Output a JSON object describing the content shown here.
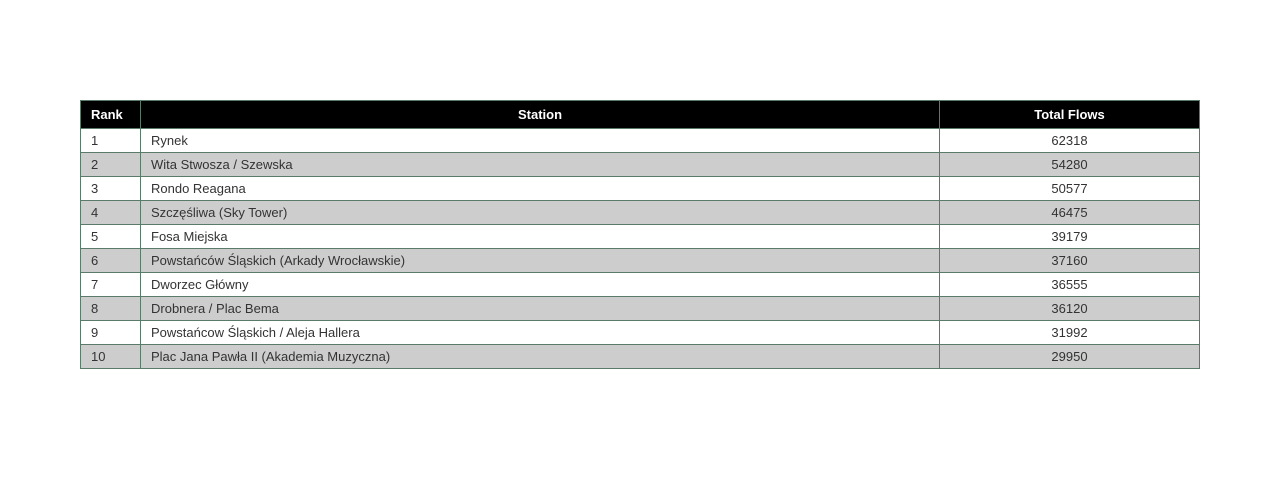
{
  "table": {
    "headers": {
      "rank": "Rank",
      "station": "Station",
      "flows": "Total Flows"
    },
    "rows": [
      {
        "rank": "1",
        "station": "Rynek",
        "flows": "62318"
      },
      {
        "rank": "2",
        "station": "Wita Stwosza / Szewska",
        "flows": "54280"
      },
      {
        "rank": "3",
        "station": "Rondo Reagana",
        "flows": "50577"
      },
      {
        "rank": "4",
        "station": "Szczęśliwa (Sky Tower)",
        "flows": "46475"
      },
      {
        "rank": "5",
        "station": "Fosa Miejska",
        "flows": "39179"
      },
      {
        "rank": "6",
        "station": "Powstańców Śląskich (Arkady Wrocławskie)",
        "flows": "37160"
      },
      {
        "rank": "7",
        "station": "Dworzec Główny",
        "flows": "36555"
      },
      {
        "rank": "8",
        "station": "Drobnera / Plac Bema",
        "flows": "36120"
      },
      {
        "rank": "9",
        "station": "Powstańcow Śląskich / Aleja Hallera",
        "flows": "31992"
      },
      {
        "rank": "10",
        "station": "Plac Jana Pawła II (Akademia Muzyczna)",
        "flows": "29950"
      }
    ]
  }
}
